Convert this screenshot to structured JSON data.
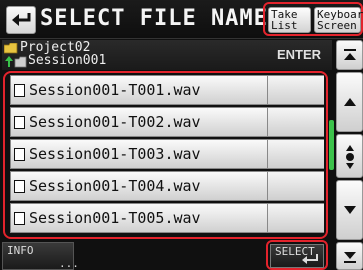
{
  "header": {
    "title": "SELECT FILE NAME",
    "take_list": [
      "Take",
      "List"
    ],
    "keyboard_screen": [
      "Keyboard",
      "Screen"
    ]
  },
  "folder": {
    "project": "Project02",
    "session": "Session001",
    "enter_label": "ENTER"
  },
  "files": [
    {
      "name": "Session001-T001.wav"
    },
    {
      "name": "Session001-T002.wav"
    },
    {
      "name": "Session001-T003.wav"
    },
    {
      "name": "Session001-T004.wav"
    },
    {
      "name": "Session001-T005.wav"
    }
  ],
  "footer": {
    "info_label": "INFO",
    "info_more": "...",
    "select_label": "SELECT"
  },
  "icons": {
    "back": "return-arrow-icon",
    "folder": "folder-icon",
    "file": "audio-file-icon",
    "scroll_top": "scroll-to-top-icon",
    "scroll_up": "scroll-up-icon",
    "scroll_position": "scroll-position-icon",
    "scroll_down": "scroll-down-icon",
    "scroll_bottom": "scroll-to-bottom-icon"
  },
  "colors": {
    "highlight_border": "#e3232c",
    "scroll_indicator": "#3cc24b"
  }
}
